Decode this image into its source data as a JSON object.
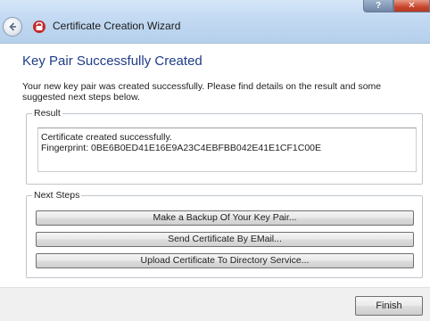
{
  "window": {
    "title": "Certificate Creation Wizard",
    "help_label": "?",
    "close_label": "✕"
  },
  "page": {
    "heading": "Key Pair Successfully Created",
    "intro": "Your new key pair was created successfully. Please find details on the result and some suggested next steps below."
  },
  "result": {
    "group_label": "Result",
    "lines": [
      "Certificate created successfully.",
      "Fingerprint: 0BE6B0ED41E16E9A23C4EBFBB042E41E1CF1C00E"
    ]
  },
  "next_steps": {
    "group_label": "Next Steps",
    "backup_label": "Make a Backup Of Your Key Pair...",
    "email_label": "Send Certificate By EMail...",
    "upload_label": "Upload Certificate To Directory Service..."
  },
  "footer": {
    "finish_label": "Finish"
  },
  "icons": {
    "back": "back-arrow-icon",
    "app": "kleopatra-app-icon"
  },
  "colors": {
    "heading": "#1f3c88",
    "titlebar": "#c2d9f2",
    "close_button": "#c8452c"
  }
}
